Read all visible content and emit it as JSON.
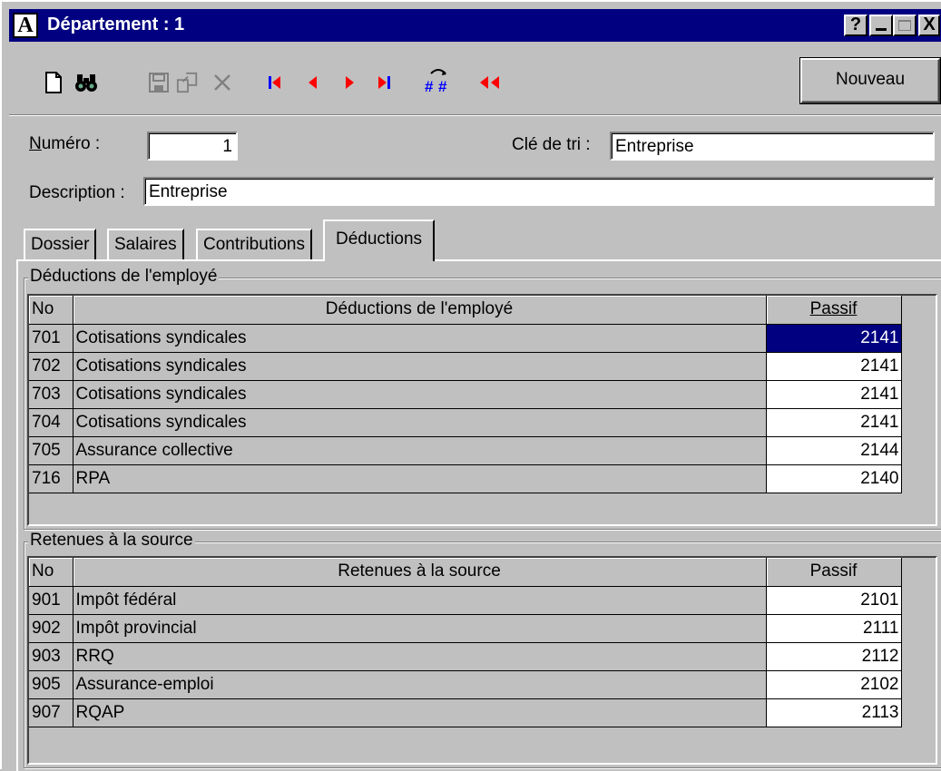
{
  "window": {
    "app_icon": "A",
    "title": "Département : 1",
    "caption_buttons": [
      "?",
      "_",
      "□",
      "X"
    ]
  },
  "toolbar": {
    "icons": [
      "new-document-icon",
      "find-binoculars-icon",
      "save-icon",
      "copy-icon",
      "delete-icon",
      "first-record-icon",
      "previous-record-icon",
      "next-record-icon",
      "last-record-icon",
      "renumber-icon",
      "go-back-icon"
    ],
    "nouveau_label": "Nouveau"
  },
  "form": {
    "numero_label": "Numéro :",
    "numero_value": "1",
    "cle_label": "Clé de tri :",
    "cle_value": "Entreprise",
    "description_label": "Description :",
    "description_value": "Entreprise"
  },
  "tabs": [
    {
      "label": "Dossier",
      "active": false
    },
    {
      "label": "Salaires",
      "active": false
    },
    {
      "label": "Contributions",
      "active": false
    },
    {
      "label": "Déductions",
      "active": true
    }
  ],
  "deductions": {
    "group_label": "Déductions de l'employé",
    "columns": [
      "No",
      "Déductions de l'employé",
      "Passif"
    ],
    "rows": [
      {
        "no": "701",
        "name": "Cotisations syndicales",
        "passif": "2141",
        "selected": true
      },
      {
        "no": "702",
        "name": "Cotisations syndicales",
        "passif": "2141"
      },
      {
        "no": "703",
        "name": "Cotisations syndicales",
        "passif": "2141"
      },
      {
        "no": "704",
        "name": "Cotisations syndicales",
        "passif": "2141"
      },
      {
        "no": "705",
        "name": "Assurance collective",
        "passif": "2144"
      },
      {
        "no": "716",
        "name": "RPA",
        "passif": "2140"
      }
    ]
  },
  "retenues": {
    "group_label": "Retenues à la source",
    "columns": [
      "No",
      "Retenues à la source",
      "Passif"
    ],
    "rows": [
      {
        "no": "901",
        "name": "Impôt fédéral",
        "passif": "2101"
      },
      {
        "no": "902",
        "name": "Impôt provincial",
        "passif": "2111"
      },
      {
        "no": "903",
        "name": "RRQ",
        "passif": "2112"
      },
      {
        "no": "905",
        "name": "Assurance-emploi",
        "passif": "2102"
      },
      {
        "no": "907",
        "name": "RQAP",
        "passif": "2113"
      }
    ]
  },
  "colors": {
    "titlebar": "#000080",
    "selection": "#000080",
    "nav_red": "#ff0000",
    "nav_blue": "#0000ff",
    "face": "#c0c0c0"
  }
}
